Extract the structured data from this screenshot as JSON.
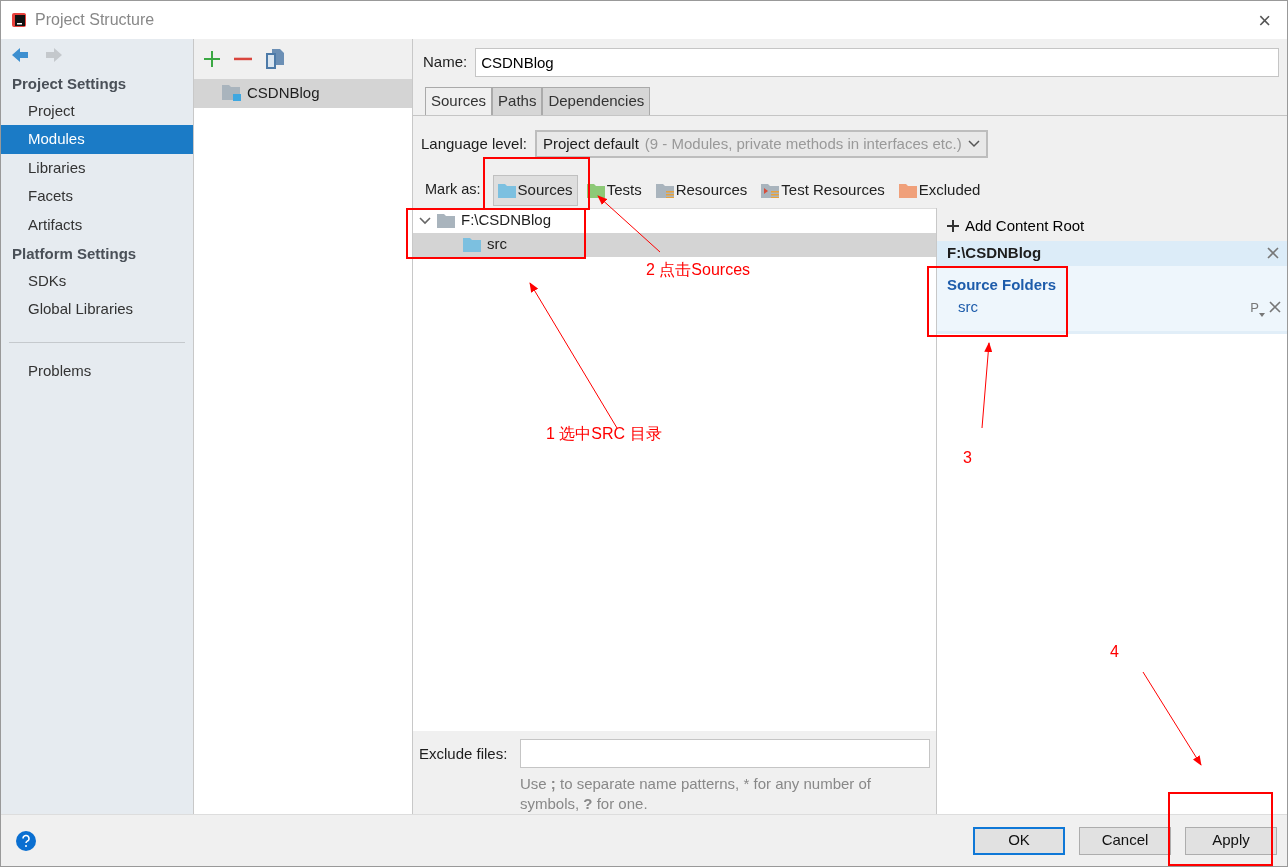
{
  "window": {
    "title": "Project Structure",
    "close": "×"
  },
  "sidebar": {
    "back_enabled": true,
    "forward_enabled": false,
    "sections": [
      {
        "title": "Project Settings",
        "items": [
          {
            "label": "Project",
            "selected": false
          },
          {
            "label": "Modules",
            "selected": true
          },
          {
            "label": "Libraries",
            "selected": false
          },
          {
            "label": "Facets",
            "selected": false
          },
          {
            "label": "Artifacts",
            "selected": false
          }
        ]
      },
      {
        "title": "Platform Settings",
        "items": [
          {
            "label": "SDKs",
            "selected": false
          },
          {
            "label": "Global Libraries",
            "selected": false
          }
        ]
      }
    ],
    "bottom_items": [
      {
        "label": "Problems",
        "selected": false
      }
    ]
  },
  "modules": {
    "items": [
      {
        "label": "CSDNBlog",
        "selected": true
      }
    ]
  },
  "name_field": {
    "label": "Name:",
    "value": "CSDNBlog"
  },
  "tabs": [
    {
      "label": "Sources",
      "selected": true
    },
    {
      "label": "Paths",
      "selected": false
    },
    {
      "label": "Dependencies",
      "selected": false
    }
  ],
  "language_level": {
    "label": "Language level:",
    "value": "Project default",
    "hint": "(9 - Modules, private methods in interfaces etc.)"
  },
  "mark_as": {
    "label": "Mark as:",
    "buttons": [
      {
        "label": "Sources",
        "color": "#7cc0e0",
        "selected": true
      },
      {
        "label": "Tests",
        "color": "#8dc977",
        "selected": false
      },
      {
        "label": "Resources",
        "color": "#a9b4bd",
        "selected": false
      },
      {
        "label": "Test Resources",
        "color": "#a9b4bd",
        "selected": false
      },
      {
        "label": "Excluded",
        "color": "#f0a07a",
        "selected": false
      }
    ]
  },
  "tree": [
    {
      "label": "F:\\CSDNBlog",
      "color": "#a9b4bd",
      "expanded": true,
      "selected": false,
      "children": [
        {
          "label": "src",
          "color": "#7cc0e0",
          "selected": true
        }
      ]
    }
  ],
  "content_roots": {
    "add_label": "Add Content Root",
    "root": "F:\\CSDNBlog",
    "section_title": "Source Folders",
    "folders": [
      {
        "label": "src",
        "prefix": "P"
      }
    ]
  },
  "exclude": {
    "label": "Exclude files:",
    "hint": "Use **;** to separate name patterns, * for any number of symbols, **?** for one."
  },
  "buttons": [
    {
      "label": "OK",
      "default": true
    },
    {
      "label": "Cancel",
      "default": false
    },
    {
      "label": "Apply",
      "default": false
    }
  ],
  "annotations": [
    {
      "label": "1 选中SRC 目录"
    },
    {
      "label": "2 点击Sources"
    },
    {
      "label": "3"
    },
    {
      "label": "4"
    }
  ]
}
